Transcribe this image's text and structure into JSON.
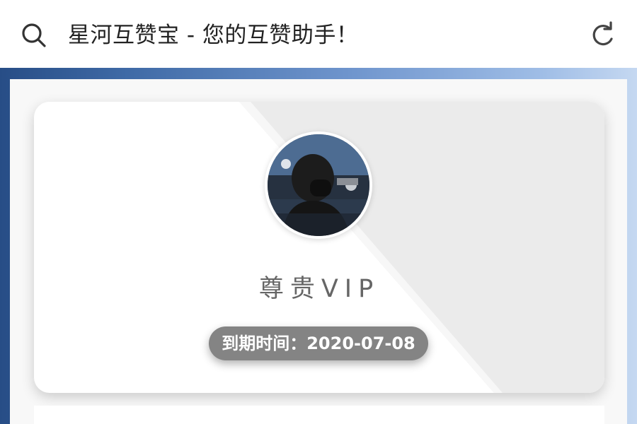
{
  "header": {
    "title": "星河互赞宝 - 您的互赞助手！",
    "search_icon": "search-icon",
    "refresh_icon": "refresh-icon"
  },
  "profile": {
    "vip_label": "尊贵VIP",
    "expiry_label": "到期时间：",
    "expiry_date": "2020-07-08"
  },
  "colors": {
    "frame_dark": "#274d86",
    "frame_light": "#c5d8f1",
    "badge_bg": "#848484",
    "diagonal_gray": "#ebebeb"
  }
}
